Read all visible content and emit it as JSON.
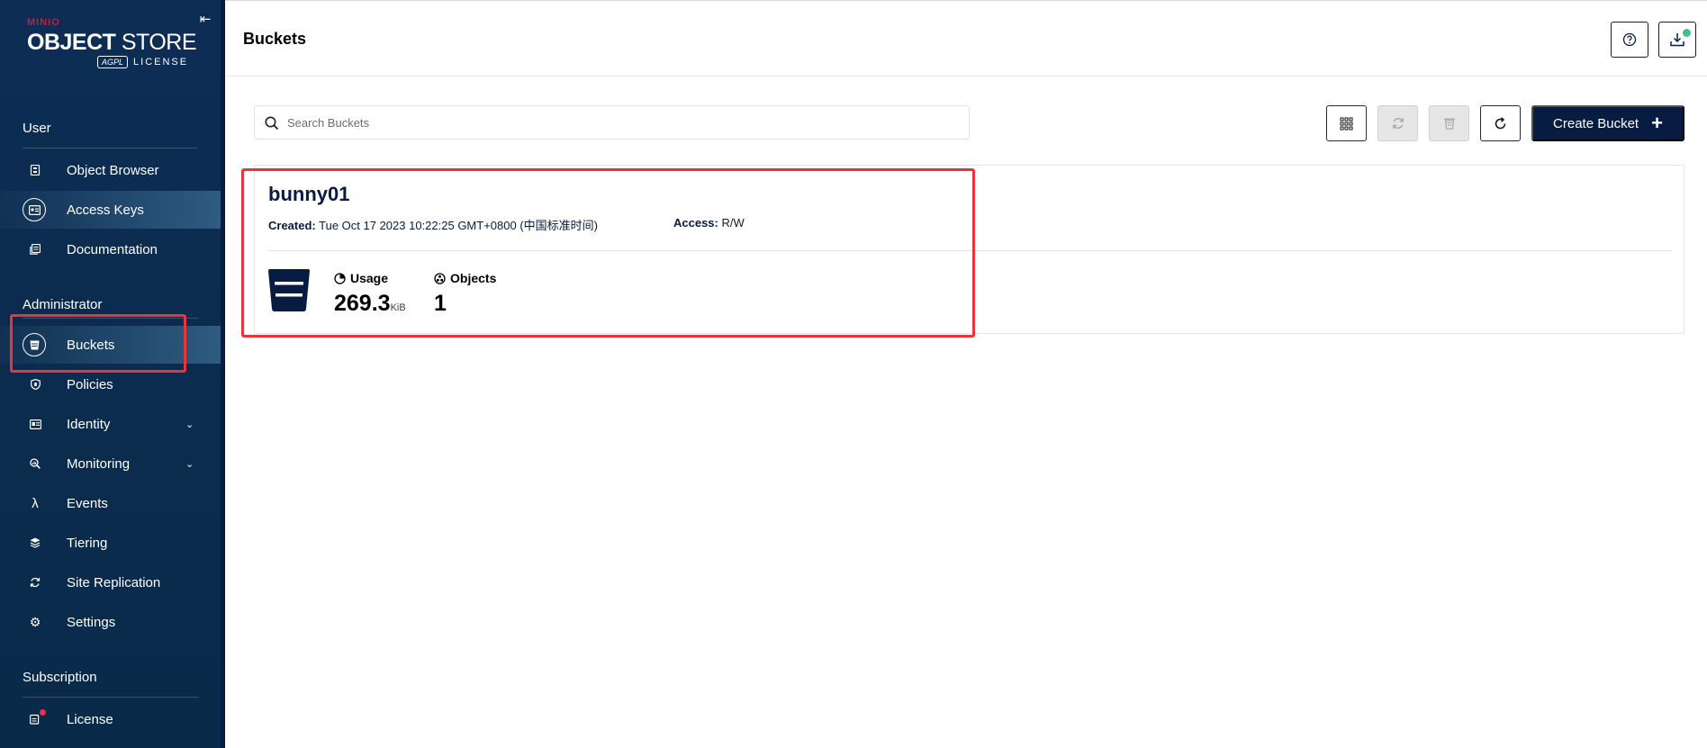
{
  "sidebar": {
    "logo": {
      "brand": "MINIO",
      "title_bold": "OBJECT",
      "title_light": "STORE",
      "badge": "AGPL",
      "license": "LICENSE"
    },
    "collapse_icon": "arrow-left-to-line-icon",
    "sections": {
      "user": "User",
      "administrator": "Administrator",
      "subscription": "Subscription"
    },
    "user_items": [
      {
        "label": "Object Browser",
        "icon": "object-browser-icon"
      },
      {
        "label": "Access Keys",
        "icon": "access-keys-icon"
      },
      {
        "label": "Documentation",
        "icon": "documentation-icon"
      }
    ],
    "admin_items": [
      {
        "label": "Buckets",
        "icon": "bucket-icon"
      },
      {
        "label": "Policies",
        "icon": "shield-icon"
      },
      {
        "label": "Identity",
        "icon": "id-card-icon"
      },
      {
        "label": "Monitoring",
        "icon": "magnifier-chart-icon"
      },
      {
        "label": "Events",
        "icon": "lambda-icon"
      },
      {
        "label": "Tiering",
        "icon": "layers-icon"
      },
      {
        "label": "Site Replication",
        "icon": "replication-icon"
      },
      {
        "label": "Settings",
        "icon": "gear-icon"
      }
    ],
    "subscription_items": [
      {
        "label": "License",
        "icon": "license-icon"
      }
    ]
  },
  "header": {
    "title": "Buckets",
    "help_icon": "help-circle-icon",
    "download_icon": "download-tray-icon"
  },
  "toolbar": {
    "search_placeholder": "Search Buckets",
    "select_icon": "grid-select-icon",
    "replication_icon": "replication-icon",
    "delete_icon": "trash-icon",
    "refresh_icon": "refresh-icon",
    "create_label": "Create Bucket",
    "create_icon": "plus-icon"
  },
  "bucket": {
    "name": "bunny01",
    "created_label": "Created:",
    "created_value": "Tue Oct 17 2023 10:22:25 GMT+0800 (中国标准时间)",
    "access_label": "Access:",
    "access_value": "R/W",
    "usage_label": "Usage",
    "usage_value": "269.3",
    "usage_unit": "KiB",
    "objects_label": "Objects",
    "objects_value": "1"
  },
  "colors": {
    "sidebar_bg": "#0d2d55",
    "primary": "#081c42",
    "highlight": "#e8343a",
    "notify_green": "#3ec58b"
  }
}
